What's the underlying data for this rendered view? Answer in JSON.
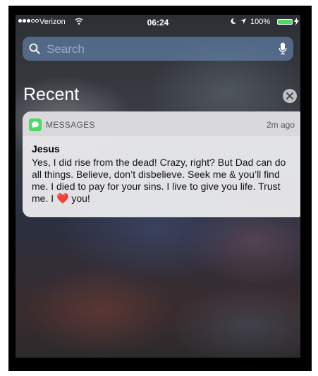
{
  "status_bar": {
    "carrier": "Verizon",
    "signal_bars_filled": 3,
    "signal_bars_total": 5,
    "time": "06:24",
    "battery_percent": "100%",
    "battery_level": 1.0,
    "icons": [
      "wifi-icon",
      "moon-icon",
      "location-icon",
      "battery-icon",
      "bolt-icon"
    ]
  },
  "search": {
    "placeholder": "Search",
    "icon": "search-icon",
    "mic_icon": "mic-icon"
  },
  "recent": {
    "title": "Recent",
    "clear_icon": "close-icon"
  },
  "notification": {
    "app_name": "MESSAGES",
    "time": "2m ago",
    "sender": "Jesus",
    "message_before_heart": "Yes, I did rise from the dead! Crazy, right? But Dad can do all things.  Believe, don’t disbelieve.  Seek me & you’ll find me. I died to pay for your sins.  I live to give you life.  Trust me. I ",
    "heart": "❤️",
    "message_after_heart": " you!",
    "colors": {
      "app_icon": "#4cd964",
      "heart": "#e0262b"
    }
  }
}
